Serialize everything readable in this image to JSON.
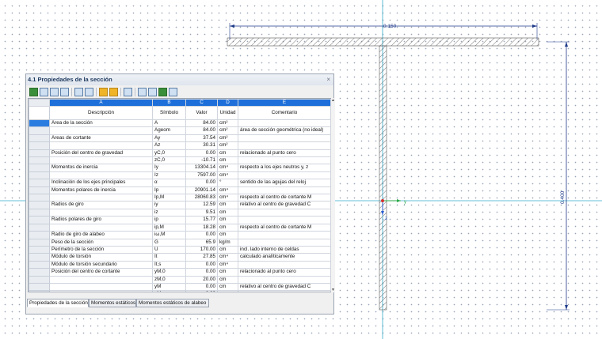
{
  "panel": {
    "title": "4.1 Propiedades de la sección",
    "close": "×",
    "columns": [
      "A",
      "B",
      "C",
      "D",
      "E"
    ],
    "headers": [
      "Descripción",
      "Símbolo",
      "Valor",
      "Unidad",
      "Comentario"
    ],
    "rows": [
      [
        "Área de la sección",
        "A",
        "84.00",
        "cm²",
        ""
      ],
      [
        "",
        "Ageom",
        "84.00",
        "cm²",
        "área de sección geométrica (no ideal)"
      ],
      [
        "Áreas de cortante",
        "Ay",
        "37.54",
        "cm²",
        ""
      ],
      [
        "",
        "Az",
        "30.31",
        "cm²",
        ""
      ],
      [
        "Posición del centro de gravedad",
        "yC,0",
        "0.00",
        "cm",
        "relacionado al punto cero"
      ],
      [
        "",
        "zC,0",
        "-10.71",
        "cm",
        ""
      ],
      [
        "Momentos de inercia",
        "Iy",
        "13304.14",
        "cm⁴",
        "respecto a los ejes neutros y, z"
      ],
      [
        "",
        "Iz",
        "7597.00",
        "cm⁴",
        ""
      ],
      [
        "Inclinación de los ejes principales",
        "α",
        "0.00",
        "°",
        "sentido de las agujas del reloj"
      ],
      [
        "Momentos polares de inercia",
        "Ip",
        "20901.14",
        "cm⁴",
        ""
      ],
      [
        "",
        "Ip,M",
        "28060.83",
        "cm⁴",
        "respecto al centro de cortante M"
      ],
      [
        "Radios de giro",
        "iy",
        "12.59",
        "cm",
        "relativo al centro de gravedad C"
      ],
      [
        "",
        "iz",
        "9.51",
        "cm",
        ""
      ],
      [
        "Radios polares de giro",
        "ip",
        "15.77",
        "cm",
        ""
      ],
      [
        "",
        "ip,M",
        "18.28",
        "cm",
        "respecto al centro de cortante M"
      ],
      [
        "Radio de giro de alabeo",
        "iω,M",
        "0.00",
        "cm",
        ""
      ],
      [
        "Peso de la sección",
        "G",
        "65.9",
        "kg/m",
        ""
      ],
      [
        "Perímetro de la sección",
        "U",
        "170.00",
        "cm",
        "incl. lado interno de celdas"
      ],
      [
        "Módulo de torsión",
        "It",
        "27.85",
        "cm⁴",
        "calculado analíticamente"
      ],
      [
        "Módulo de torsión secundario",
        "It,s",
        "0.00",
        "cm⁴",
        ""
      ],
      [
        "Posición del centro de cortante",
        "yM,0",
        "0.00",
        "cm",
        "relacionado al punto cero"
      ],
      [
        "",
        "zM,0",
        "20.00",
        "cm",
        ""
      ],
      [
        "",
        "yM",
        "0.00",
        "cm",
        "relativo al centro de gravedad C"
      ],
      [
        "",
        "zM",
        "-9.29",
        "cm",
        ""
      ]
    ],
    "tabs": [
      "Propiedades de la sección",
      "Momentos estáticos",
      "Momentos estáticos de alabeo"
    ]
  },
  "drawing": {
    "dim_width": "0.150",
    "dim_height": "0.400",
    "axis_y_label": "y",
    "axis_z_label": "z",
    "colors": {
      "dimension": "#1f3a8a",
      "hatch": "#444444",
      "cross": "#33aacc",
      "grid": "#9aa6b8",
      "accent": "#1e6fd9"
    }
  }
}
